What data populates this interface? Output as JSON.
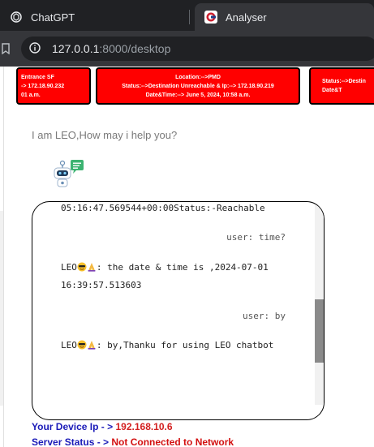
{
  "browser": {
    "tabs": [
      {
        "title": "ChatGPT",
        "icon": "openai-icon",
        "active": false
      },
      {
        "title": "Analyser",
        "icon": "analyser-favicon-icon",
        "active": true
      }
    ],
    "url": {
      "host": "127.0.0.1",
      "rest": ":8000/desktop"
    }
  },
  "cards": [
    {
      "lines": [
        "Entrance SF",
        "-> 172.18.90.232",
        "01 a.m."
      ]
    },
    {
      "lines": [
        "Location:-->PMD",
        "Status:-->Destination Unreachable & Ip:--> 172.18.90.219",
        "Date&Time:--> June 5, 2024, 10:58 a.m."
      ]
    },
    {
      "lines": [
        "",
        "Status:-->Destin",
        "Date&T"
      ]
    }
  ],
  "greeting": "I am LEO,How may i help you?",
  "chat": {
    "top_partial": "05:16:47.569544+00:00Status:-Reachable",
    "messages": [
      {
        "role": "user",
        "text": "user: time?"
      },
      {
        "role": "bot",
        "prefix": "LEO",
        "text": ": the date & time is ,2024-07-01 16:39:57.513603"
      },
      {
        "role": "user",
        "text": "user: by"
      },
      {
        "role": "bot",
        "prefix": "LEO",
        "text": ": by,Thanku for using LEO chatbot"
      }
    ]
  },
  "footer": {
    "device_label": "Your Device Ip - > ",
    "device_ip": "192.168.10.6",
    "server_label": "Server Status - > ",
    "server_status": "Not Connected to Network"
  },
  "colors": {
    "card_bg": "#ff0000",
    "label_blue": "#1a1ab8",
    "value_red": "#d32020"
  }
}
